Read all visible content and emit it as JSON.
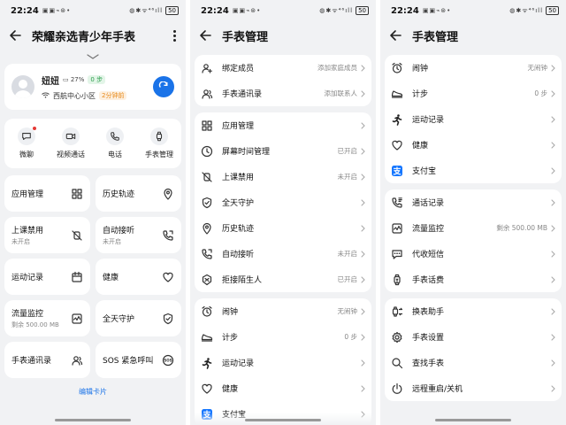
{
  "status": {
    "time": "22:24",
    "notif_icons": "▣▣⌁⊛•",
    "right_icons": "◍✱ᯤ⁴⁶ıll",
    "battery": "50"
  },
  "screen1": {
    "title": "荣耀亲选青少年手表",
    "profile": {
      "name": "妞妞",
      "battery": "27%",
      "steps": "0 步",
      "location": "西航中心小区",
      "time_ago": "2分钟前"
    },
    "quick": [
      {
        "label": "微聊",
        "icon": "chat-icon"
      },
      {
        "label": "视频通话",
        "icon": "video-call-icon"
      },
      {
        "label": "电话",
        "icon": "phone-icon"
      },
      {
        "label": "手表管理",
        "icon": "watch-icon"
      }
    ],
    "cards": [
      {
        "label": "应用管理",
        "sub": "",
        "icon": "grid-icon"
      },
      {
        "label": "历史轨迹",
        "sub": "",
        "icon": "location-pin-icon"
      },
      {
        "label": "上课禁用",
        "sub": "未开启",
        "icon": "class-disable-icon"
      },
      {
        "label": "自动接听",
        "sub": "未开启",
        "icon": "auto-answer-icon"
      },
      {
        "label": "运动记录",
        "sub": "",
        "icon": "calendar-icon"
      },
      {
        "label": "健康",
        "sub": "",
        "icon": "heart-icon"
      },
      {
        "label": "流量监控",
        "sub": "剩余 500.00 MB",
        "icon": "traffic-monitor-icon"
      },
      {
        "label": "全天守护",
        "sub": "",
        "icon": "shield-check-icon"
      },
      {
        "label": "手表通讯录",
        "sub": "",
        "icon": "contacts-icon"
      },
      {
        "label": "SOS 紧急呼叫",
        "sub": "",
        "icon": "sos-icon"
      }
    ],
    "edit_cards": "编辑卡片"
  },
  "screen2": {
    "title": "手表管理",
    "groups": [
      [
        {
          "label": "绑定成员",
          "value": "添加家庭成员",
          "icon": "add-member-icon"
        },
        {
          "label": "手表通讯录",
          "value": "添加联系人",
          "icon": "contacts-icon"
        }
      ],
      [
        {
          "label": "应用管理",
          "value": "",
          "icon": "grid-icon"
        },
        {
          "label": "屏幕时间管理",
          "value": "已开启",
          "icon": "clock-icon"
        },
        {
          "label": "上课禁用",
          "value": "未开启",
          "icon": "class-disable-icon"
        },
        {
          "label": "全天守护",
          "value": "",
          "icon": "shield-check-icon"
        },
        {
          "label": "历史轨迹",
          "value": "",
          "icon": "location-pin-icon"
        },
        {
          "label": "自动接听",
          "value": "未开启",
          "icon": "auto-answer-icon"
        },
        {
          "label": "拒接陌生人",
          "value": "已开启",
          "icon": "block-stranger-icon"
        }
      ],
      [
        {
          "label": "闹钟",
          "value": "无闹钟",
          "icon": "alarm-icon"
        },
        {
          "label": "计步",
          "value": "0 步",
          "icon": "shoe-icon"
        },
        {
          "label": "运动记录",
          "value": "",
          "icon": "running-icon"
        },
        {
          "label": "健康",
          "value": "",
          "icon": "heart-icon"
        },
        {
          "label": "支付宝",
          "value": "",
          "icon": "alipay-icon"
        }
      ]
    ]
  },
  "screen3": {
    "title": "手表管理",
    "groups": [
      [
        {
          "label": "闹钟",
          "value": "无闹钟",
          "icon": "alarm-icon"
        },
        {
          "label": "计步",
          "value": "0 步",
          "icon": "shoe-icon"
        },
        {
          "label": "运动记录",
          "value": "",
          "icon": "running-icon"
        },
        {
          "label": "健康",
          "value": "",
          "icon": "heart-icon"
        },
        {
          "label": "支付宝",
          "value": "",
          "icon": "alipay-icon"
        }
      ],
      [
        {
          "label": "通话记录",
          "value": "",
          "icon": "call-log-icon"
        },
        {
          "label": "流量监控",
          "value": "剩余 500.00 MB",
          "icon": "traffic-monitor-icon"
        },
        {
          "label": "代收短信",
          "value": "",
          "icon": "sms-icon"
        },
        {
          "label": "手表话费",
          "value": "",
          "icon": "watch-bill-icon"
        }
      ],
      [
        {
          "label": "换表助手",
          "value": "",
          "icon": "switch-watch-icon"
        },
        {
          "label": "手表设置",
          "value": "",
          "icon": "gear-icon"
        },
        {
          "label": "查找手表",
          "value": "",
          "icon": "search-icon"
        },
        {
          "label": "远程重启/关机",
          "value": "",
          "icon": "power-icon"
        }
      ]
    ]
  },
  "colors": {
    "accent": "#1a73e8",
    "background": "#f1f2f4",
    "card": "#ffffff",
    "alipay": "#1677ff"
  }
}
